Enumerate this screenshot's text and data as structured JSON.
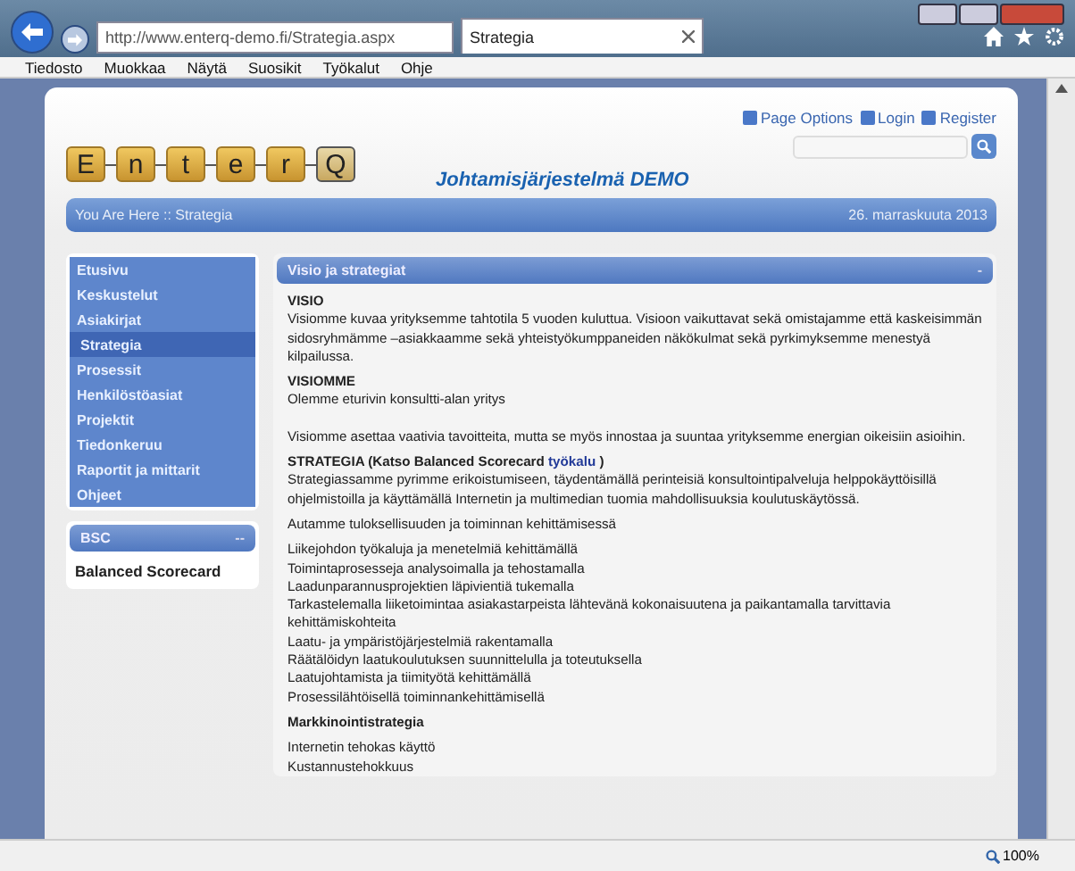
{
  "browser": {
    "url": "http://www.enterq-demo.fi/Strategia.aspx",
    "tab_title": "Strategia",
    "menu": [
      "Tiedosto",
      "Muokkaa",
      "Näytä",
      "Suosikit",
      "Työkalut",
      "Ohje"
    ]
  },
  "header": {
    "logo": [
      {
        "char": "E",
        "accent": false
      },
      {
        "char": "n",
        "accent": false
      },
      {
        "char": "t",
        "accent": false
      },
      {
        "char": "e",
        "accent": false
      },
      {
        "char": "r",
        "accent": false
      },
      {
        "char": "Q",
        "accent": true
      }
    ],
    "links": [
      "Page Options",
      "Login",
      "Register"
    ],
    "subtitle": "Johtamisjärjestelmä DEMO"
  },
  "breadcrumb": {
    "text": "You Are Here :: Strategia",
    "date": "26. marraskuuta 2013"
  },
  "nav": [
    {
      "label": "Etusivu",
      "selected": false
    },
    {
      "label": "Keskustelut",
      "selected": false
    },
    {
      "label": "Asiakirjat",
      "selected": false
    },
    {
      "label": "Strategia",
      "selected": true
    },
    {
      "label": "Prosessit",
      "selected": false
    },
    {
      "label": "Henkilöstöasiat",
      "selected": false
    },
    {
      "label": "Projektit",
      "selected": false
    },
    {
      "label": "Tiedonkeruu",
      "selected": false
    },
    {
      "label": "Raportit ja mittarit",
      "selected": false
    },
    {
      "label": "Ohjeet",
      "selected": false
    }
  ],
  "bsc": {
    "title": "BSC",
    "toggle": "--",
    "items": [
      "Balanced Scorecard"
    ]
  },
  "panel": {
    "title": "Visio ja strategiat",
    "toggle": "-",
    "blocks": [
      {
        "kind": "heading",
        "text": "VISIO"
      },
      {
        "kind": "paragraph",
        "text": "Visiomme kuvaa yrityksemme tahtotila 5 vuoden kuluttua. Visioon vaikuttavat sekä omistajamme että kaskeisimmän sidosryhmämme –asiakkaamme sekä yhteistyökumppaneiden näkökulmat sekä pyrkimyksemme menestyä kilpailussa."
      },
      {
        "kind": "heading",
        "text": "VISIOMME"
      },
      {
        "kind": "paragraph",
        "text": "Olemme eturivin konsultti-alan yritys"
      },
      {
        "kind": "paragraph",
        "text": "Visiomme asettaa vaativia tavoitteita, mutta se myös innostaa ja suuntaa yrityksemme energian oikeisiin asioihin."
      },
      {
        "kind": "link_heading",
        "text": "STRATEGIA (Katso Balanced Scorecard",
        "link": "työkalu",
        "after": ")"
      },
      {
        "kind": "paragraph",
        "text": "Strategiassamme pyrimme erikoistumiseen, täydentämällä perinteisiä konsultointipalveluja helppokäyttöisillä ohjelmistoilla ja käyttämällä Internetin ja multimedian tuomia mahdollisuuksia koulutuskäytössä."
      },
      {
        "kind": "paragraph",
        "text": "Autamme tuloksellisuuden ja toiminnan kehittämisessä"
      },
      {
        "kind": "lines",
        "items": [
          "Liikejohdon työkaluja ja menetelmiä kehittämällä",
          "Toimintaprosesseja analysoimalla ja tehostamalla",
          "Laadunparannusprojektien läpivientiä tukemalla",
          "Tarkastelemalla liiketoimintaa asiakastarpeista lähtevänä kokonaisuutena ja paikantamalla tarvittavia kehittämiskohteita",
          "Laatu- ja ympäristöjärjestelmiä rakentamalla",
          "Räätälöidyn laatukoulutuksen suunnittelulla ja toteutuksella",
          "Laatujohtamista ja tiimityötä kehittämällä",
          "Prosessilähtöisellä toiminnankehittämisellä"
        ]
      },
      {
        "kind": "heading",
        "text": "Markkinointistrategia"
      },
      {
        "kind": "lines",
        "items": [
          "Internetin tehokas käyttö",
          "Kustannustehokkuus"
        ]
      }
    ]
  },
  "status": {
    "zoom": "100%"
  }
}
